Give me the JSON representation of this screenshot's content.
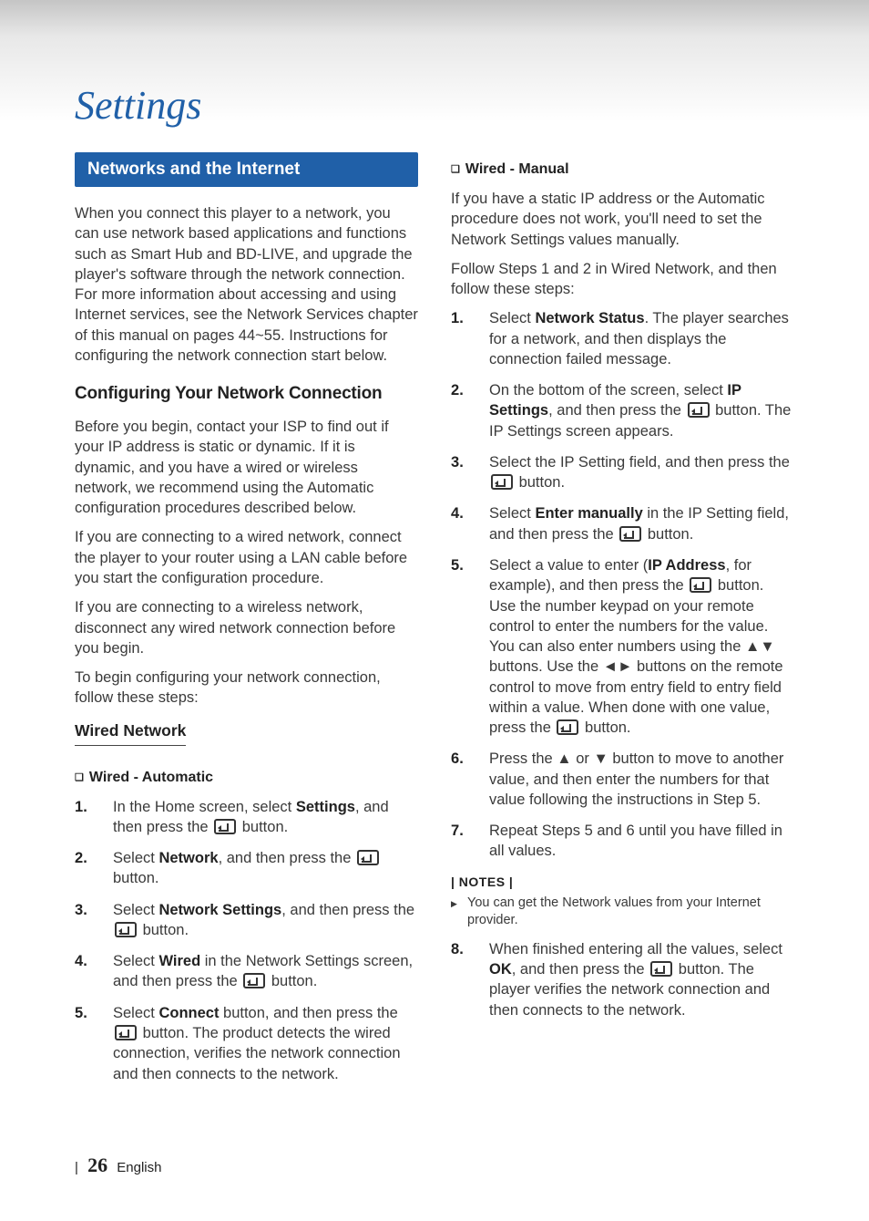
{
  "chapter": "Settings",
  "left": {
    "sectionBar": "Networks and the Internet",
    "intro": "When you connect this player to a network, you can use network based applications and functions such as Smart Hub and BD-LIVE, and upgrade the player's software through the network connection. For more information about accessing and using Internet services, see the Network Services chapter of this manual on pages 44~55. Instructions for configuring the network connection start below.",
    "h2": "Configuring Your Network Connection",
    "para1": "Before you begin, contact your ISP to find out if your IP address is static or dynamic. If it is dynamic, and you have a wired or wireless network, we recommend using the Automatic configuration procedures described below.",
    "para2": "If you are connecting to a wired network, connect the player to your router using a LAN cable before you start the configuration procedure.",
    "para3": "If you are connecting to a wireless network, disconnect any wired network connection before you begin.",
    "para4": "To begin configuring your network connection, follow these steps:",
    "h3": "Wired Network",
    "subA": "Wired - Automatic",
    "stepsA": {
      "s1a": "In the Home screen, select ",
      "s1b": "Settings",
      "s1c": ", and then press the ",
      "s1d": " button.",
      "s2a": "Select ",
      "s2b": "Network",
      "s2c": ", and then press the ",
      "s2d": " button.",
      "s3a": "Select ",
      "s3b": "Network Settings",
      "s3c": ", and then press the ",
      "s3d": " button.",
      "s4a": "Select ",
      "s4b": "Wired",
      "s4c": " in the Network Settings screen, and then press the ",
      "s4d": " button.",
      "s5a": "Select ",
      "s5b": "Connect",
      "s5c": " button, and then press the ",
      "s5d": " button. The product detects the wired connection, verifies the network connection and then connects to the network."
    }
  },
  "right": {
    "subB": "Wired - Manual",
    "introB1": "If you have a static IP address or the Automatic procedure does not work, you'll need to set the Network Settings values manually.",
    "introB2": "Follow Steps 1 and 2 in Wired Network, and then follow these steps:",
    "stepsB": {
      "s1a": "Select ",
      "s1b": "Network Status",
      "s1c": ". The player searches for a network, and then displays the connection failed message.",
      "s2a": "On the bottom of the screen, select ",
      "s2b": "IP Settings",
      "s2c": ", and then press the ",
      "s2d": " button. The IP Settings screen appears.",
      "s3a": "Select the IP Setting field, and then press the ",
      "s3b": " button.",
      "s4a": "Select ",
      "s4b": "Enter manually",
      "s4c": " in the IP Setting field, and then press the ",
      "s4d": " button.",
      "s5a": "Select a value to enter (",
      "s5b": "IP Address",
      "s5c": ", for example), and then press the ",
      "s5d": " button. Use the number keypad on your remote control to enter the numbers for the value. You can also enter numbers using the ▲▼ buttons. Use the ◄► buttons on the remote control to move from entry field to entry field within a value. When done with one value, press the ",
      "s5e": " button.",
      "s6": "Press the ▲ or ▼ button to move to another value, and then enter the numbers for that value following the instructions in Step 5.",
      "s7": "Repeat Steps 5 and 6 until you have filled in all values."
    },
    "notesHeading": "| NOTES |",
    "note1": "You can get the Network values from your Internet provider.",
    "s8a": "When finished entering all the values, select ",
    "s8b": "OK",
    "s8c": ", and then press the ",
    "s8d": " button. The player verifies the network connection and then connects to the network."
  },
  "footer": {
    "pipe": "|",
    "page": "26",
    "lang": "English"
  }
}
